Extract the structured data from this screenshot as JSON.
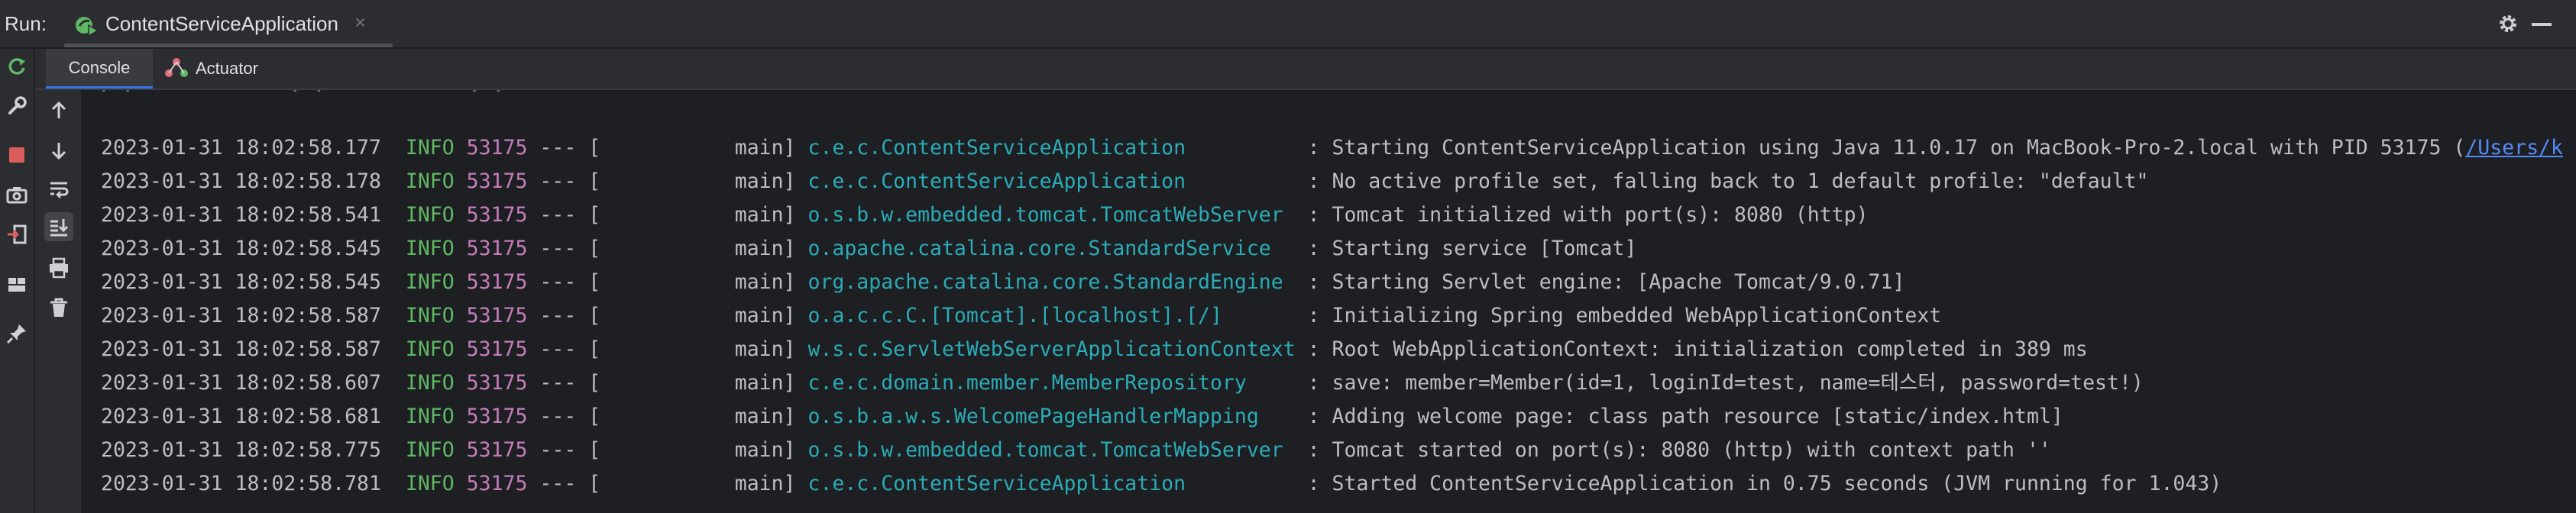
{
  "header": {
    "run_label": "Run:",
    "tab_title": "ContentServiceApplication",
    "tab_close": "×"
  },
  "subtabs": {
    "console": "Console",
    "actuator": "Actuator"
  },
  "log": {
    "level": "INFO",
    "pid": "53175",
    "separator": "---",
    "thread_open": "[",
    "thread": "main]",
    "lines": [
      {
        "time": "2023-01-31 18:02:58.177",
        "logger": "c.e.c.ContentServiceApplication",
        "message": ": Starting ContentServiceApplication using Java 11.0.17 on MacBook-Pro-2.local with PID 53175 (",
        "link": "/Users/k"
      },
      {
        "time": "2023-01-31 18:02:58.178",
        "logger": "c.e.c.ContentServiceApplication",
        "message": ": No active profile set, falling back to 1 default profile: \"default\"",
        "link": ""
      },
      {
        "time": "2023-01-31 18:02:58.541",
        "logger": "o.s.b.w.embedded.tomcat.TomcatWebServer",
        "message": ": Tomcat initialized with port(s): 8080 (http)",
        "link": ""
      },
      {
        "time": "2023-01-31 18:02:58.545",
        "logger": "o.apache.catalina.core.StandardService",
        "message": ": Starting service [Tomcat]",
        "link": ""
      },
      {
        "time": "2023-01-31 18:02:58.545",
        "logger": "org.apache.catalina.core.StandardEngine",
        "message": ": Starting Servlet engine: [Apache Tomcat/9.0.71]",
        "link": ""
      },
      {
        "time": "2023-01-31 18:02:58.587",
        "logger": "o.a.c.c.C.[Tomcat].[localhost].[/]",
        "message": ": Initializing Spring embedded WebApplicationContext",
        "link": ""
      },
      {
        "time": "2023-01-31 18:02:58.587",
        "logger": "w.s.c.ServletWebServerApplicationContext",
        "message": ": Root WebApplicationContext: initialization completed in 389 ms",
        "link": ""
      },
      {
        "time": "2023-01-31 18:02:58.607",
        "logger": "c.e.c.domain.member.MemberRepository",
        "message": ": save: member=Member(id=1, loginId=test, name=테스터, password=test!)",
        "link": ""
      },
      {
        "time": "2023-01-31 18:02:58.681",
        "logger": "o.s.b.a.w.s.WelcomePageHandlerMapping",
        "message": ": Adding welcome page: class path resource [static/index.html]",
        "link": ""
      },
      {
        "time": "2023-01-31 18:02:58.775",
        "logger": "o.s.b.w.embedded.tomcat.TomcatWebServer",
        "message": ": Tomcat started on port(s): 8080 (http) with context path ''",
        "link": ""
      },
      {
        "time": "2023-01-31 18:02:58.781",
        "logger": "c.e.c.ContentServiceApplication",
        "message": ": Started ContentServiceApplication in 0.75 seconds (JVM running for 1.043)",
        "link": ""
      }
    ]
  },
  "icons": {
    "left_bar": [
      "rerun-icon",
      "wrench-icon",
      "stop-icon",
      "camera-icon",
      "exit-icon",
      "layout-icon",
      "pin-icon"
    ],
    "tool_col": [
      "arrow-up-icon",
      "arrow-down-icon",
      "soft-wrap-icon",
      "scroll-to-end-icon",
      "print-icon",
      "trash-icon"
    ],
    "header": [
      "gear-icon",
      "minimize-icon"
    ]
  },
  "colors": {
    "info": "#5fb865",
    "pid": "#c77dbb",
    "logger": "#2aacb8",
    "link": "#548af7",
    "accent": "#3574f0"
  }
}
